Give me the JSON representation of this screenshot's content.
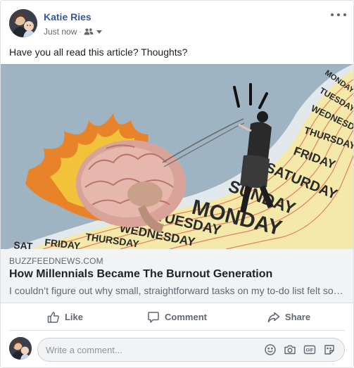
{
  "post": {
    "author": "Katie Ries",
    "timestamp": "Just now",
    "audience_icon": "friends-icon",
    "text": "Have you all read this article? Thoughts?"
  },
  "link": {
    "source": "BUZZFEEDNEWS.COM",
    "title": "How Millennials Became The Burnout Generation",
    "description": "I couldn’t figure out why small, straightforward tasks on my to-do list felt so hard to do."
  },
  "illustration": {
    "weekday_words": [
      "MONDAY",
      "TUESDAY",
      "WEDNESDAY",
      "THURSDAY",
      "FRIDAY",
      "SATURDAY",
      "SUNDAY",
      "MONDAY",
      "TUESDAY",
      "WEDNESDAY",
      "THURSDAY",
      "FRIDAY",
      "SAT"
    ]
  },
  "actions": {
    "like": "Like",
    "comment": "Comment",
    "share": "Share"
  },
  "comment_box": {
    "placeholder": "Write a comment..."
  },
  "colors": {
    "author_link": "#385898",
    "secondary_text": "#606770",
    "link_panel_bg": "#f2f3f5",
    "image_sky": "#9db3c2",
    "image_paper": "#f3e7a8"
  }
}
